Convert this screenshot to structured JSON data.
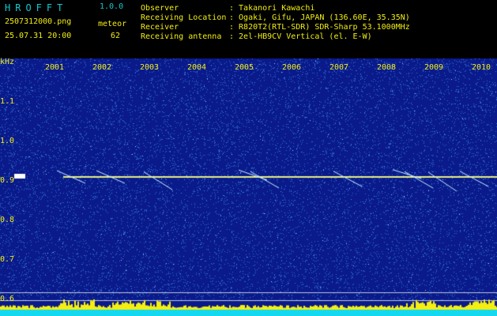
{
  "header": {
    "app_name": "HROFFT",
    "version": "1.0.0",
    "filename": "2507312000.png",
    "datetime": "25.07.31 20:00",
    "meteor_label": "meteor",
    "meteor_count": "62",
    "fields": [
      {
        "label": "Observer",
        "value": ": Takanori Kawachi"
      },
      {
        "label": "Receiving Location",
        "value": ": Ogaki, Gifu, JAPAN (136.60E, 35.35N)"
      },
      {
        "label": "Receiver",
        "value": ": R820T2(RTL-SDR) SDR-Sharp 53.1000MHz"
      },
      {
        "label": "Receiving antenna",
        "value": ": 2el-HB9CV Vertical (el. E-W)"
      }
    ]
  },
  "spectrogram": {
    "y_unit": "kHz",
    "y_ticks": [
      "1.1",
      "1.0",
      "0.9",
      "0.8",
      "0.7",
      "0.6"
    ],
    "x_ticks": [
      "2001",
      "2002",
      "2003",
      "2004",
      "2005",
      "2006",
      "2007",
      "2008",
      "2009",
      "2010"
    ],
    "carrier_khz": 0.91,
    "colors": {
      "background": "#0a1a8a",
      "noise": "#2e6ad8",
      "carrier": "#e8f080",
      "activity": "#f5ee10",
      "baseline": "#14d8f0"
    }
  }
}
